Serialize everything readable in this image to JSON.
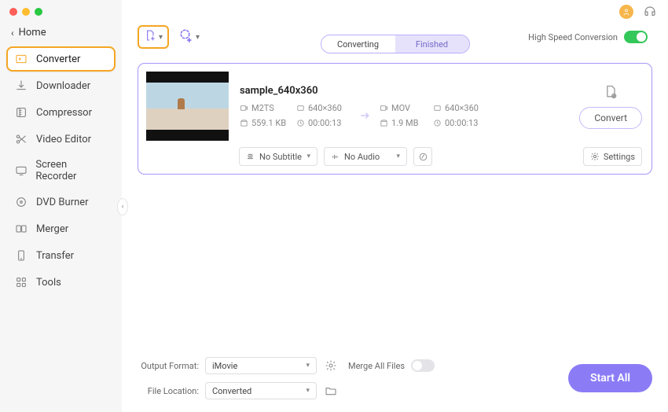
{
  "nav": {
    "home": "Home",
    "items": [
      {
        "label": "Converter"
      },
      {
        "label": "Downloader"
      },
      {
        "label": "Compressor"
      },
      {
        "label": "Video Editor"
      },
      {
        "label": "Screen Recorder"
      },
      {
        "label": "DVD Burner"
      },
      {
        "label": "Merger"
      },
      {
        "label": "Transfer"
      },
      {
        "label": "Tools"
      }
    ]
  },
  "header": {
    "tabs": {
      "converting": "Converting",
      "finished": "Finished"
    },
    "hs_label": "High Speed Conversion"
  },
  "file": {
    "name": "sample_640x360",
    "src": {
      "format": "M2TS",
      "res": "640×360",
      "size": "559.1 KB",
      "dur": "00:00:13"
    },
    "dst": {
      "format": "MOV",
      "res": "640×360",
      "size": "1.9 MB",
      "dur": "00:00:13"
    },
    "subtitle": "No Subtitle",
    "audio": "No Audio",
    "settings": "Settings",
    "convert": "Convert"
  },
  "bottom": {
    "output_format_label": "Output Format:",
    "output_format_value": "iMovie",
    "file_location_label": "File Location:",
    "file_location_value": "Converted",
    "merge_label": "Merge All Files",
    "start_all": "Start All"
  }
}
